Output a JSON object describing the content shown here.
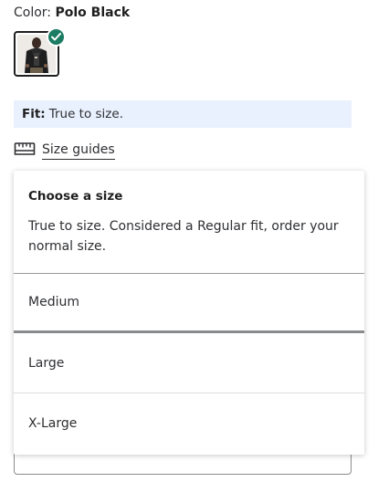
{
  "color": {
    "label": "Color:",
    "value": "Polo Black",
    "swatch_icon": "product-thumbnail",
    "check_color": "#1c7c63"
  },
  "fit": {
    "label": "Fit:",
    "text": "True to size."
  },
  "size_guides": {
    "icon": "ruler-icon",
    "label": "Size guides"
  },
  "size_menu": {
    "title": "Choose a size",
    "description": "True to size. Considered a Regular fit, order your normal size.",
    "options": [
      {
        "label": "Medium",
        "selected": true
      },
      {
        "label": "Large",
        "selected": false
      },
      {
        "label": "X-Large",
        "selected": false
      }
    ]
  },
  "colors": {
    "banner_bg": "#e9f1fe",
    "accent_green": "#1c7c63",
    "text": "#2e2f32"
  }
}
